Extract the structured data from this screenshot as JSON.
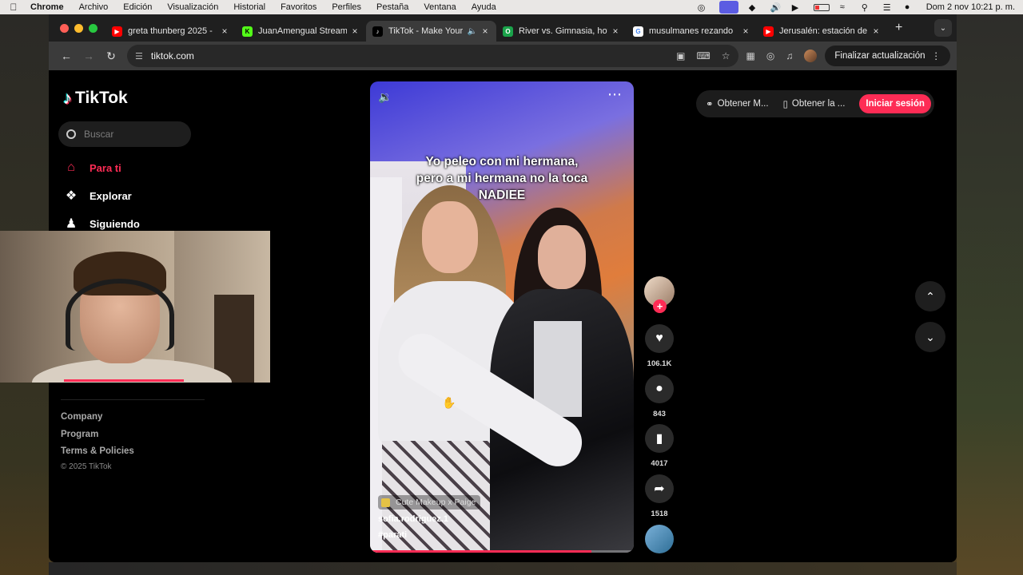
{
  "macos_menu": {
    "apple": "",
    "app": "Chrome",
    "items": [
      "Archivo",
      "Edición",
      "Visualización",
      "Historial",
      "Favoritos",
      "Perfiles",
      "Pestaña",
      "Ventana",
      "Ayuda"
    ],
    "clock": "Dom 2 nov  10:21 p. m."
  },
  "browser": {
    "tabs": [
      {
        "title": "greta thunberg 2025 -",
        "favicon": "youtube-icon",
        "color": "#ff0000"
      },
      {
        "title": "JuanAmengual Stream",
        "favicon": "kick-icon",
        "color": "#53fc18"
      },
      {
        "title": "TikTok - Make Your",
        "favicon": "tiktok-icon",
        "color": "#000000",
        "active": true
      },
      {
        "title": "River vs. Gimnasia, hoy",
        "favicon": "ole-icon",
        "color": "#1aa34a"
      },
      {
        "title": "musulmanes rezando",
        "favicon": "google-icon",
        "color": "#4285f4"
      },
      {
        "title": "Jerusalén: estación de",
        "favicon": "youtube-icon",
        "color": "#ff0000"
      }
    ],
    "url": "tiktok.com",
    "update_button": "Finalizar actualización"
  },
  "tiktok": {
    "logo": "TikTok",
    "search_placeholder": "Buscar",
    "nav": [
      {
        "label": "Para ti",
        "icon": "home-icon",
        "active": true
      },
      {
        "label": "Explorar",
        "icon": "compass-icon"
      },
      {
        "label": "Siguiendo",
        "icon": "following-icon"
      }
    ],
    "footer": [
      "Company",
      "Program",
      "Terms & Policies"
    ],
    "copyright": "© 2025 TikTok",
    "top_right": {
      "get_app_1": "Obtener M...",
      "get_app_2": "Obtener la ...",
      "login": "Iniciar sesión"
    },
    "video": {
      "caption_line1": "Yo peleo con mi hermana,",
      "caption_line2": "pero a mi hermana no la toca",
      "caption_line3": "NADIEE",
      "music": "Cute Makeup x Paige",
      "username": "sofia.rodriguez.1",
      "hashtag": "#parati",
      "progress": 0.84
    },
    "actions": {
      "likes": "106.1K",
      "comments": "843",
      "saves": "4017",
      "shares": "1518"
    }
  }
}
